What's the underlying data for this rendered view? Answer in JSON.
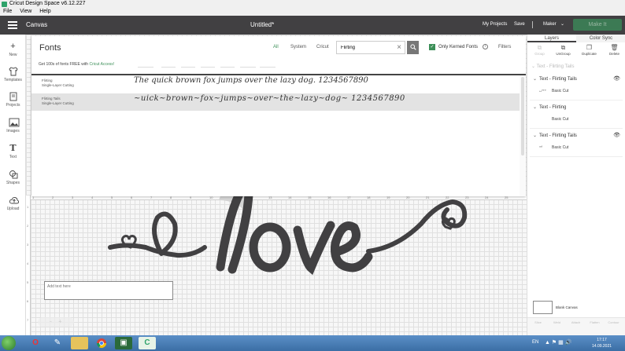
{
  "window": {
    "title": "Cricut Design Space  v6.12.227",
    "menu": [
      "File",
      "View",
      "Help"
    ]
  },
  "header": {
    "section": "Canvas",
    "doc_title": "Untitled*",
    "my_projects": "My Projects",
    "save": "Save",
    "machine": "Maker",
    "make_it": "Make It"
  },
  "left_rail": [
    {
      "label": "New",
      "icon": "plus-icon"
    },
    {
      "label": "Templates",
      "icon": "shirt-icon"
    },
    {
      "label": "Projects",
      "icon": "projects-icon"
    },
    {
      "label": "Images",
      "icon": "image-icon"
    },
    {
      "label": "Text",
      "icon": "text-icon"
    },
    {
      "label": "Shapes",
      "icon": "shapes-icon"
    },
    {
      "label": "Upload",
      "icon": "upload-icon"
    }
  ],
  "fonts_panel": {
    "title": "Fonts",
    "tabs": [
      "All",
      "System",
      "Cricut"
    ],
    "active_tab": "All",
    "search_value": "Flirting",
    "only_kerned_label": "Only Kerned Fonts",
    "only_kerned_checked": true,
    "filters_label": "Filters",
    "promo_text": "Get 100s of fonts FREE with ",
    "promo_link": "Cricut Access!",
    "rows": [
      {
        "name": "Flirting",
        "sub": "Single-Layer Cutting",
        "sample": "The quick brown fox jumps over the lazy dog. 1234567890"
      },
      {
        "name": "Flirting Tails",
        "sub": "Single-Layer Cutting",
        "sample": "~uick~brown~fox~jumps~over~the~lazy~dog~ 1234567890"
      }
    ]
  },
  "canvas": {
    "art_text": "love",
    "add_text_placeholder": "Add text here",
    "ruler_numbers": [
      "1",
      "2",
      "3",
      "4",
      "5",
      "6",
      "7",
      "8",
      "9",
      "10",
      "11",
      "12",
      "13",
      "14",
      "15",
      "16",
      "17",
      "18",
      "19",
      "20",
      "21",
      "22",
      "23",
      "24",
      "25"
    ],
    "ruler_left_numbers": [
      "1",
      "2",
      "3",
      "4",
      "5",
      "6",
      "7"
    ]
  },
  "right_panel": {
    "tabs": [
      "Layers",
      "Color Sync"
    ],
    "active_tab": "Layers",
    "tools": [
      "Group",
      "UnGroup",
      "Duplicate",
      "Delete"
    ],
    "ghost_header": "Text - Flirting Tails",
    "layers": [
      {
        "title": "Text - Flirting Tails",
        "child": "Basic Cut",
        "thumb": "ᴗᵒᵛᵉ"
      },
      {
        "title": "Text - Flirting",
        "child": "Basic Cut",
        "thumb": ""
      },
      {
        "title": "Text - Flirting Tails",
        "child": "Basic Cut",
        "thumb": "ᵃᵈ"
      }
    ],
    "blank_canvas": "Blank Canvas",
    "bottom_tools": [
      "Slice",
      "Weld",
      "Attach",
      "Flatten",
      "Contour"
    ]
  },
  "taskbar": {
    "lang": "EN",
    "time": "17:17",
    "date": "14.09.2021"
  },
  "colors": {
    "header_bg": "#414042",
    "accent_green": "#3c8f58",
    "love_fill": "#414042"
  }
}
